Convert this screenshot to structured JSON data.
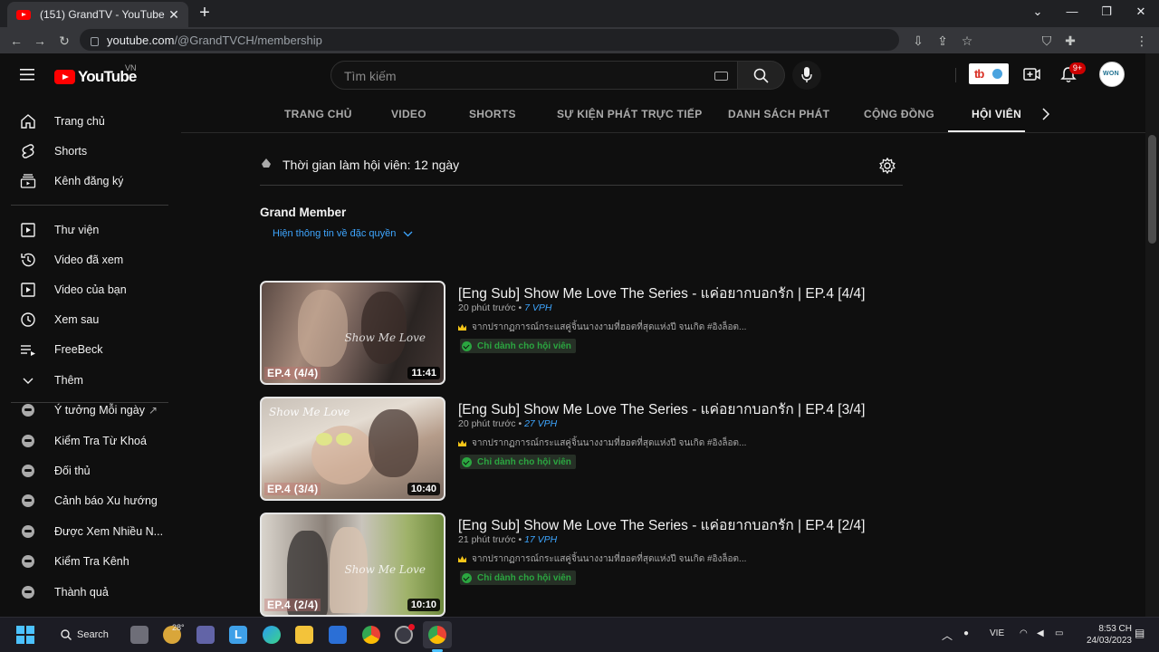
{
  "browser": {
    "tab_title": "(151) GrandTV - YouTube",
    "new_tab": "+",
    "url_host": "youtube.com",
    "url_path": "/@GrandTVCH/membership"
  },
  "header": {
    "logo_text": "YouTube",
    "country_code": "VN",
    "search_placeholder": "Tìm kiếm",
    "notification_count": "9+",
    "avatar_text": "WON"
  },
  "sidebar": {
    "main": [
      {
        "label": "Trang chủ",
        "icon": "home-icon"
      },
      {
        "label": "Shorts",
        "icon": "shorts-icon"
      },
      {
        "label": "Kênh đăng ký",
        "icon": "subscriptions-icon"
      }
    ],
    "library": [
      {
        "label": "Thư viện",
        "icon": "library-icon"
      },
      {
        "label": "Video đã xem",
        "icon": "history-icon"
      },
      {
        "label": "Video của bạn",
        "icon": "your-videos-icon"
      },
      {
        "label": "Xem sau",
        "icon": "watch-later-icon"
      },
      {
        "label": "FreeBeck",
        "icon": "playlist-icon"
      },
      {
        "label": "Thêm",
        "icon": "chevron-down-icon"
      }
    ],
    "extensions": [
      {
        "label": "Ý tưởng Mỗi ngày",
        "external": "↗"
      },
      {
        "label": "Kiểm Tra Từ Khoá"
      },
      {
        "label": "Đối thủ"
      },
      {
        "label": "Cảnh báo Xu hướng"
      },
      {
        "label": "Được Xem Nhiều N..."
      },
      {
        "label": "Kiểm Tra Kênh"
      },
      {
        "label": "Thành quả"
      }
    ]
  },
  "channel_tabs": [
    {
      "label": "TRANG CHỦ"
    },
    {
      "label": "VIDEO"
    },
    {
      "label": "SHORTS"
    },
    {
      "label": "SỰ KIỆN PHÁT TRỰC TIẾP"
    },
    {
      "label": "DANH SÁCH PHÁT"
    },
    {
      "label": "CỘNG ĐỒNG"
    },
    {
      "label": "HỘI VIÊN",
      "active": true
    }
  ],
  "membership": {
    "duration_text": "Thời gian làm hội viên: 12 ngày",
    "level_name": "Grand Member",
    "perks_link": "Hiện thông tin về đặc quyền"
  },
  "videos": [
    {
      "title": "[Eng Sub] Show Me Love The Series - แค่อยากบอกรัก | EP.4 [4/4]",
      "time_ago": "20 phút trước",
      "separator": "•",
      "vph": "7 VPH",
      "description": "จากปรากฏการณ์กระแสคู่จิ้นนางงามที่ฮอตที่สุดแห่งปี จนเกิด #อิงล็อต...",
      "badge": "Chỉ dành cho hội viên",
      "duration": "11:41",
      "episode": "EP.4 (4/4)",
      "logo_text": "Show Me Love"
    },
    {
      "title": "[Eng Sub] Show Me Love The Series - แค่อยากบอกรัก | EP.4 [3/4]",
      "time_ago": "20 phút trước",
      "separator": "•",
      "vph": "27 VPH",
      "description": "จากปรากฏการณ์กระแสคู่จิ้นนางงามที่ฮอตที่สุดแห่งปี จนเกิด #อิงล็อต...",
      "badge": "Chỉ dành cho hội viên",
      "duration": "10:40",
      "episode": "EP.4 (3/4)",
      "logo_text": "Show Me Love"
    },
    {
      "title": "[Eng Sub] Show Me Love The Series - แค่อยากบอกรัก | EP.4 [2/4]",
      "time_ago": "21 phút trước",
      "separator": "•",
      "vph": "17 VPH",
      "description": "จากปรากฏการณ์กระแสคู่จิ้นนางงามที่ฮอตที่สุดแห่งปี จนเกิด #อิงล็อต...",
      "badge": "Chỉ dành cho hội viên",
      "duration": "10:10",
      "episode": "EP.4 (2/4)",
      "logo_text": "Show Me Love"
    }
  ],
  "taskbar": {
    "search_label": "Search",
    "weather_temp": "28°",
    "language": "VIE",
    "time": "8:53 CH",
    "date": "24/03/2023"
  },
  "colors": {
    "background": "#0f0f0f",
    "accent_red": "#ff0000",
    "link_blue": "#3ea6ff",
    "member_green": "#2ba640"
  }
}
